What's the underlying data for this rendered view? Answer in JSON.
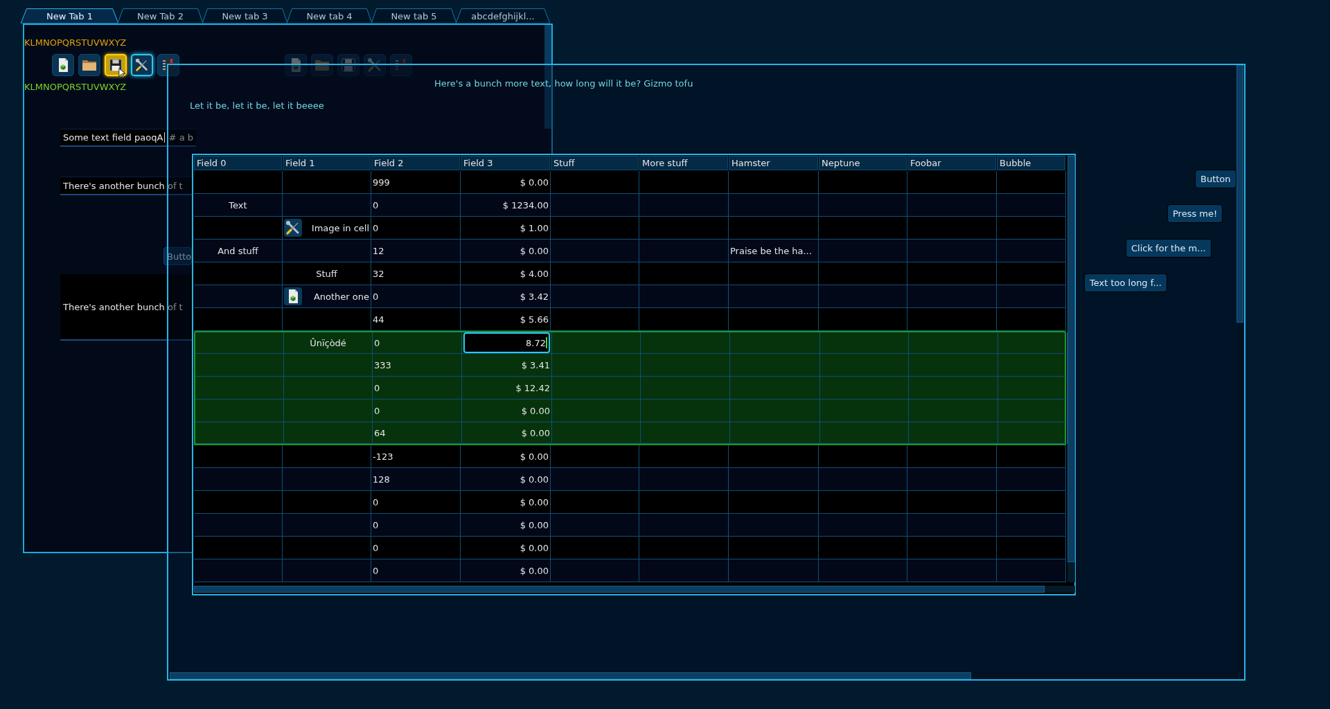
{
  "back_window": {
    "tabs": [
      {
        "label": "New Tab 1",
        "selected": true
      },
      {
        "label": "New Tab 2",
        "selected": false
      },
      {
        "label": "New tab 3",
        "selected": false
      },
      {
        "label": "New tab 4",
        "selected": false
      },
      {
        "label": "New tab 5",
        "selected": false
      },
      {
        "label": "abcdefghijkl...",
        "selected": false
      }
    ],
    "alphabet_labels": [
      {
        "text": "KLMNOPQRSTUVWXYZ",
        "color": "#e0a000"
      },
      {
        "text": "KLMNOPQRSTUVWXYZ",
        "color": "#7ed321"
      }
    ],
    "toolbar": [
      {
        "kind": "document",
        "hovered": false,
        "focused": false
      },
      {
        "kind": "folder",
        "hovered": false,
        "focused": false
      },
      {
        "kind": "floppy",
        "hovered": true,
        "focused": false
      },
      {
        "kind": "tools",
        "hovered": false,
        "focused": true
      },
      {
        "kind": "notebook",
        "hovered": false,
        "focused": false
      }
    ],
    "disabled_toolbar": {
      "disabled": true,
      "items": [
        {
          "kind": "document"
        },
        {
          "kind": "folder"
        },
        {
          "kind": "floppy"
        },
        {
          "kind": "tools"
        },
        {
          "kind": "notebook"
        }
      ]
    },
    "text_field": {
      "value_before_caret": "Some text field paoqA",
      "value_after_caret": "# a b"
    },
    "text_field_2": {
      "value": "There's another bunch of t"
    },
    "button": "Butto",
    "text_area": {
      "value": "There's another bunch of t"
    }
  },
  "front_window": {
    "heading": "Here's a bunch more text, how long will it be? Gizmo tofu",
    "subheading": "Let it be, let it be, let it beeee",
    "table": {
      "columns": [
        {
          "label": "Field 0"
        },
        {
          "label": "Field 1"
        },
        {
          "label": "Field 2"
        },
        {
          "label": "Field 3"
        },
        {
          "label": "Stuff"
        },
        {
          "label": "More stuff"
        },
        {
          "label": "Hamster"
        },
        {
          "label": "Neptune"
        },
        {
          "label": "Foobar"
        },
        {
          "label": "Bubble"
        }
      ],
      "rows": [
        {
          "selected": false,
          "cells": [
            null,
            null,
            "999",
            "$ 0.00"
          ]
        },
        {
          "selected": false,
          "cells": [
            "Text",
            null,
            "0",
            "$ 1234.00"
          ]
        },
        {
          "selected": false,
          "cells": [
            null,
            {
              "text": "Image in cell",
              "kind": "image"
            },
            "0",
            "$ 1.00"
          ]
        },
        {
          "selected": false,
          "cells": [
            "And stuff",
            null,
            "12",
            "$ 0.00",
            null,
            null,
            "Praise be the ha..."
          ]
        },
        {
          "selected": false,
          "cells": [
            null,
            "Stuff",
            "32",
            "$ 4.00"
          ]
        },
        {
          "selected": false,
          "cells": [
            null,
            {
              "text": "Another one",
              "kind": "image"
            },
            "0",
            "$ 3.42"
          ]
        },
        {
          "selected": false,
          "cells": [
            null,
            null,
            "44",
            "$ 5.66"
          ]
        },
        {
          "selected": true,
          "cells": [
            null,
            "Ûnïçòdé",
            "0",
            {
              "text": "8.72",
              "kind": "editor"
            }
          ]
        },
        {
          "selected": true,
          "cells": [
            null,
            null,
            "333",
            "$ 3.41"
          ]
        },
        {
          "selected": true,
          "cells": [
            null,
            null,
            "0",
            "$ 12.42"
          ]
        },
        {
          "selected": true,
          "cells": [
            null,
            null,
            "0",
            "$ 0.00"
          ]
        },
        {
          "selected": true,
          "cells": [
            null,
            null,
            "64",
            "$ 0.00"
          ]
        },
        {
          "selected": false,
          "cells": [
            null,
            null,
            "-123",
            "$ 0.00"
          ]
        },
        {
          "selected": false,
          "cells": [
            null,
            null,
            "128",
            "$ 0.00"
          ]
        },
        {
          "selected": false,
          "cells": [
            null,
            null,
            "0",
            "$ 0.00"
          ]
        },
        {
          "selected": false,
          "cells": [
            null,
            null,
            "0",
            "$ 0.00"
          ]
        },
        {
          "selected": false,
          "cells": [
            null,
            null,
            "0",
            "$ 0.00"
          ]
        },
        {
          "selected": false,
          "cells": [
            null,
            null,
            "0",
            "$ 0.00"
          ]
        }
      ]
    },
    "buttons": [
      "Button",
      "Press me!",
      "Click for the m...",
      "Text too long f..."
    ]
  }
}
